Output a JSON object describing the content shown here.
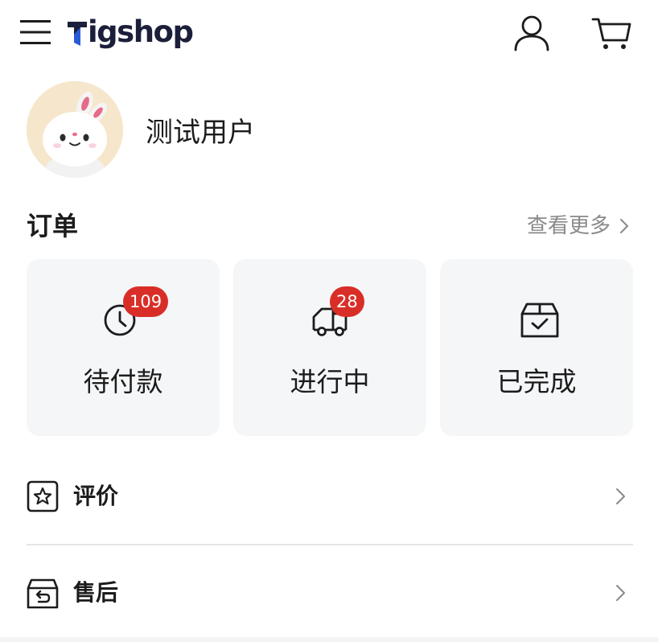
{
  "header": {
    "logo": "Tigshop",
    "logo_colors": {
      "mark": "#2a5bd7",
      "text": "#1b1f3a"
    },
    "icons": [
      "menu-icon",
      "user-icon",
      "cart-icon"
    ]
  },
  "profile": {
    "username": "测试用户",
    "avatar_icon": "bunny-avatar"
  },
  "orders": {
    "title": "订单",
    "view_more": "查看更多",
    "cards": [
      {
        "label": "待付款",
        "badge": "109",
        "icon": "clock-icon"
      },
      {
        "label": "进行中",
        "badge": "28",
        "icon": "truck-icon"
      },
      {
        "label": "已完成",
        "badge": "",
        "icon": "box-check-icon"
      }
    ]
  },
  "menu": [
    {
      "label": "评价",
      "icon": "star-square-icon"
    },
    {
      "label": "售后",
      "icon": "return-box-icon"
    }
  ],
  "colors": {
    "badge": "#d92e27",
    "card_bg": "#f5f6f8",
    "muted_text": "#8a8a8a"
  }
}
